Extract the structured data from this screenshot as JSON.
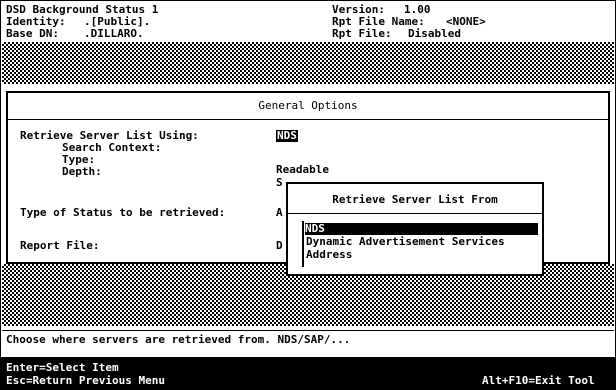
{
  "header": {
    "title": "DSD Background Status 1",
    "identity_label": "Identity:",
    "identity_value": ".[Public].",
    "base_dn_label": "Base DN:",
    "base_dn_value": ".DILLARO.",
    "version_label": "Version:",
    "version_value": "1.00",
    "rpt_name_label": "Rpt File Name:",
    "rpt_name_value": "<NONE>",
    "rpt_file_label": "Rpt File:",
    "rpt_file_value": "Disabled"
  },
  "general_options": {
    "title": "General Options",
    "retrieve_label": "Retrieve Server List Using:",
    "retrieve_value": "NDS",
    "search_context_label": "Search Context:",
    "search_context_value": "",
    "type_label": "Type:",
    "type_value": "Readable",
    "depth_label": "Depth:",
    "depth_value_fragment": "S",
    "status_type_label": "Type of Status to be retrieved:",
    "status_type_value_fragment": "A",
    "report_file_label": "Report File:",
    "report_file_value_fragment": "D"
  },
  "popup": {
    "title": "Retrieve Server List From",
    "selected_index": 0,
    "options": [
      "NDS",
      "Dynamic Advertisement Services",
      "Address"
    ]
  },
  "status_line": "Choose where servers are retrieved from. NDS/SAP/...",
  "footer": {
    "enter_hint": "Enter=Select Item",
    "esc_hint": "Esc=Return Previous Menu",
    "exit_hint": "Alt+F10=Exit Tool"
  }
}
